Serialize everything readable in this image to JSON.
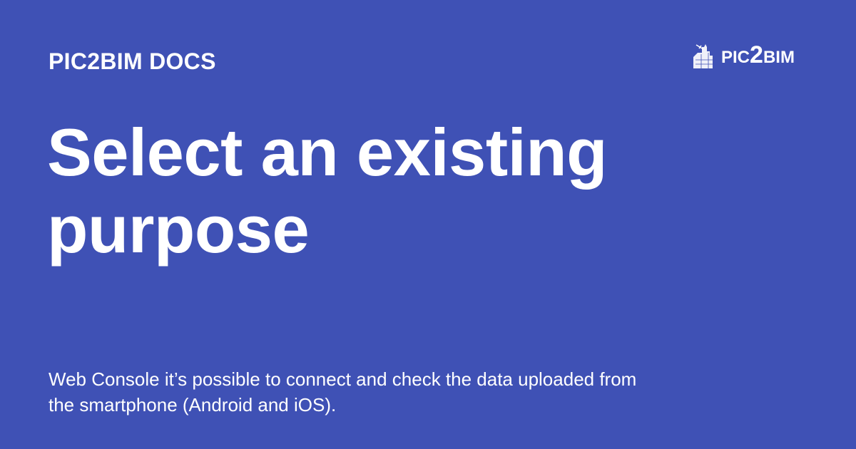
{
  "site": {
    "name": "PIC2BIM DOCS"
  },
  "logo": {
    "part1": "PIC",
    "part2": "2",
    "part3": "BIM"
  },
  "page": {
    "title": "Select an existing purpose",
    "description": "Web Console it’s possible to connect and check the data uploaded from the smartphone (Android and iOS)."
  },
  "colors": {
    "background": "#3f51b5",
    "text": "#ffffff"
  }
}
